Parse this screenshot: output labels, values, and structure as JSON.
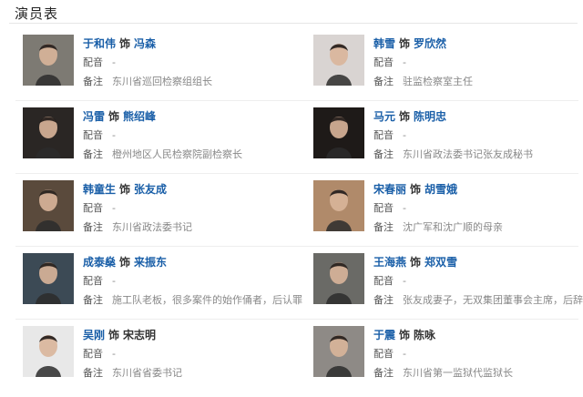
{
  "page_title": "演员表",
  "shi_word": "饰",
  "labels": {
    "dubbing": "配音",
    "note": "备注"
  },
  "cast": [
    {
      "actor": "于和伟",
      "role": "冯森",
      "role_linked": true,
      "dubbing": "-",
      "note": "东川省巡回检察组组长",
      "photo_tone": "#7d7a73"
    },
    {
      "actor": "韩雪",
      "role": "罗欣然",
      "role_linked": true,
      "dubbing": "-",
      "note": "驻监检察室主任",
      "photo_tone": "#d9d4d2"
    },
    {
      "actor": "冯雷",
      "role": "熊绍峰",
      "role_linked": true,
      "dubbing": "-",
      "note": "橙州地区人民检察院副检察长",
      "photo_tone": "#2a2624"
    },
    {
      "actor": "马元",
      "role": "陈明忠",
      "role_linked": true,
      "dubbing": "-",
      "note": "东川省政法委书记张友成秘书",
      "photo_tone": "#1e1a18"
    },
    {
      "actor": "韩童生",
      "role": "张友成",
      "role_linked": true,
      "dubbing": "-",
      "note": "东川省政法委书记",
      "photo_tone": "#5a4a3c"
    },
    {
      "actor": "宋春丽",
      "role": "胡雪娥",
      "role_linked": true,
      "dubbing": "-",
      "note": "沈广军和沈广顺的母亲",
      "photo_tone": "#b08a6a"
    },
    {
      "actor": "成泰燊",
      "role": "来振东",
      "role_linked": true,
      "dubbing": "-",
      "note": "施工队老板，很多案件的始作俑者，后认罪",
      "photo_tone": "#3c4a55"
    },
    {
      "actor": "王海燕",
      "role": "郑双雪",
      "role_linked": true,
      "dubbing": "-",
      "note": "张友成妻子，无双集团董事会主席，后辞职",
      "photo_tone": "#6a6a66"
    },
    {
      "actor": "吴刚",
      "role": "宋志明",
      "role_linked": false,
      "dubbing": "-",
      "note": "东川省省委书记",
      "photo_tone": "#e8e8e8"
    },
    {
      "actor": "于震",
      "role": "陈咏",
      "role_linked": false,
      "dubbing": "-",
      "note": "东川省第一监狱代监狱长",
      "photo_tone": "#8e8a86"
    }
  ]
}
